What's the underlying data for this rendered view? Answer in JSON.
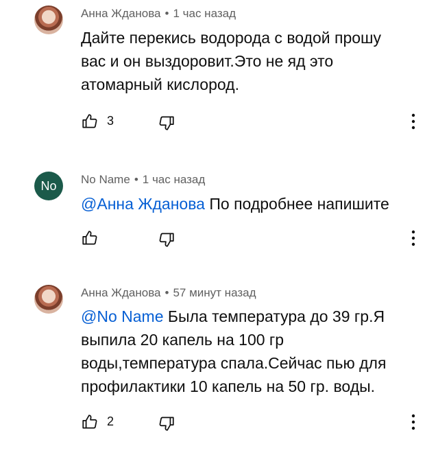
{
  "comments": [
    {
      "author": "Анна Жданова",
      "separator": "•",
      "time": "1 час назад",
      "mention": "",
      "text_lines": [
        "Дайте перекись водорода с водой прошу",
        "вас и он выздоровит.Это не яд это",
        "атомарный кислород."
      ],
      "likes": "3",
      "avatar_type": "photo"
    },
    {
      "author": "No Name",
      "avatar_letter": "No",
      "separator": "•",
      "time": "1 час назад",
      "mention": "@Анна Жданова",
      "text_lines": [
        "По подробнее напишите"
      ],
      "likes": "",
      "avatar_type": "letter",
      "avatar_color": "#1b5a4a"
    },
    {
      "author": "Анна Жданова",
      "separator": "•",
      "time": "57 минут назад",
      "mention": "@No Name",
      "text_lines": [
        "Была температура до 39 гр.Я",
        "выпила 20 капель на 100 гр",
        "воды,температура спала.Сейчас пью для",
        "профилактики 10 капель на 50 гр. воды."
      ],
      "likes": "2",
      "avatar_type": "photo"
    }
  ],
  "icons": {
    "like": "thumbs-up-icon",
    "dislike": "thumbs-down-icon",
    "more": "more-vertical-icon"
  },
  "colors": {
    "mention": "#065fd4",
    "meta": "#606060",
    "text": "#0f0f0f"
  }
}
